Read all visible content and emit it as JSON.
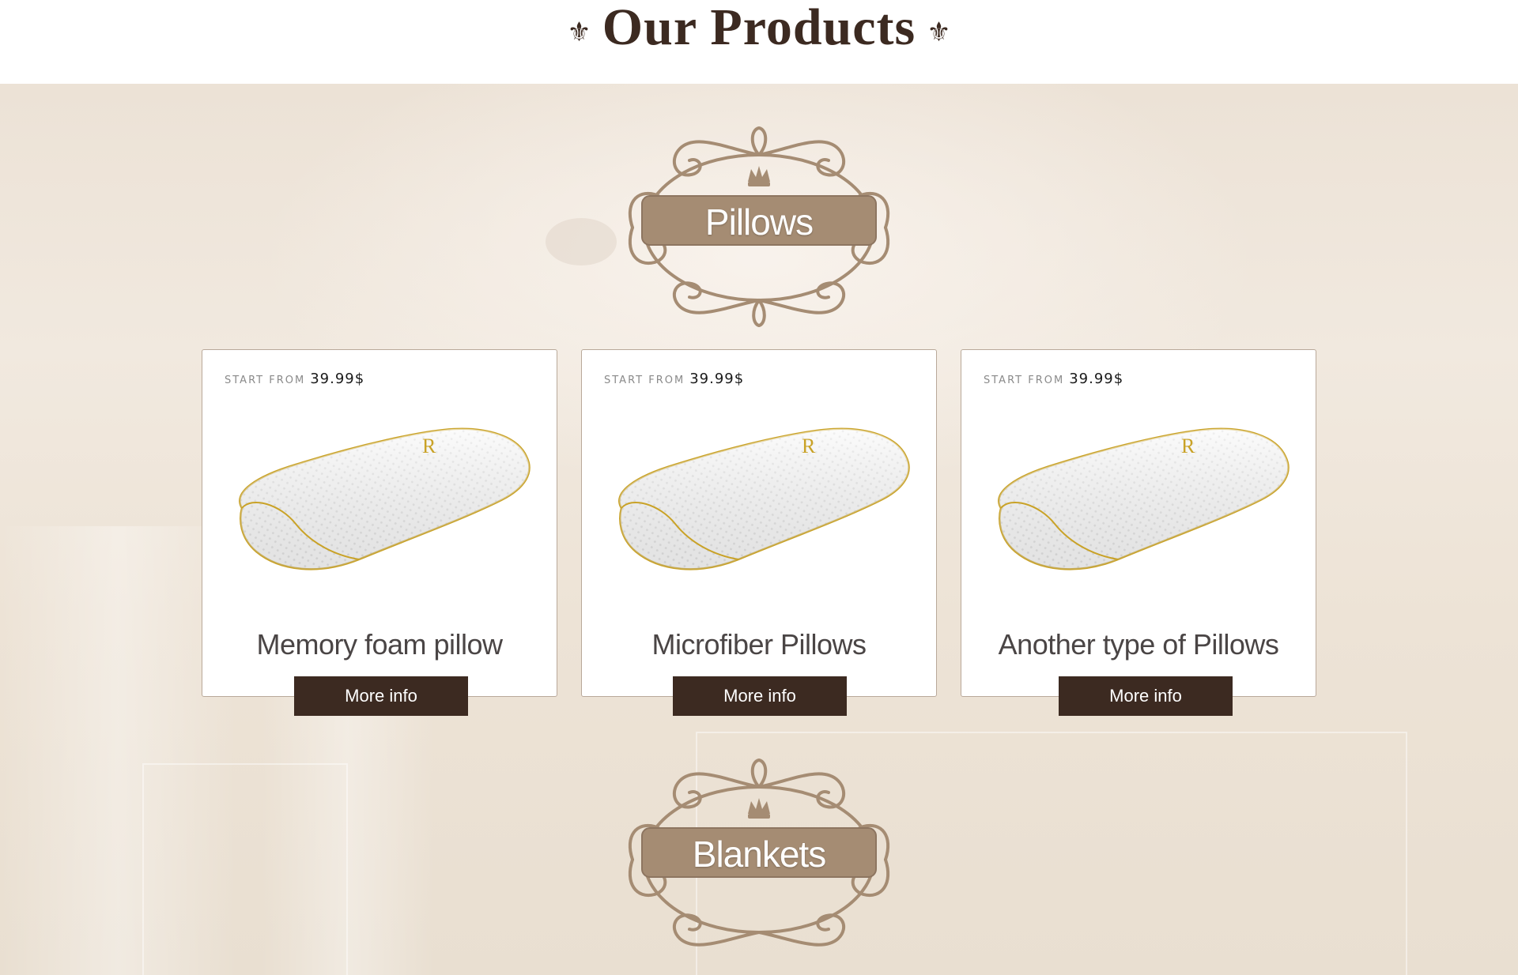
{
  "header": {
    "title": "Our Products",
    "left_ornament": "⚜",
    "right_ornament": "⚜"
  },
  "sections": [
    {
      "label": "Pillows"
    },
    {
      "label": "Blankets"
    }
  ],
  "products": [
    {
      "price_prefix": "START FROM",
      "price": "39.99$",
      "name": "Memory foam pillow",
      "button": "More info"
    },
    {
      "price_prefix": "START FROM",
      "price": "39.99$",
      "name": "Microfiber Pillows",
      "button": "More info"
    },
    {
      "price_prefix": "START FROM",
      "price": "39.99$",
      "name": "Another type of  Pillows",
      "button": "More info"
    }
  ],
  "colors": {
    "brand_dark": "#3c2a21",
    "emblem_brown": "#a58c73",
    "pillow_trim": "#c9a227",
    "background": "#efe6db"
  }
}
